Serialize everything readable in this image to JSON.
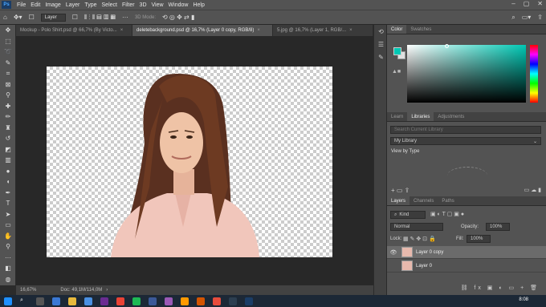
{
  "menubar": {
    "logo": "Ps",
    "items": [
      "File",
      "Edit",
      "Image",
      "Layer",
      "Type",
      "Select",
      "Filter",
      "3D",
      "View",
      "Window",
      "Help"
    ]
  },
  "options": {
    "auto_select": "Layer",
    "mode3d": "3D Mode:"
  },
  "tabs": [
    {
      "label": "Mockup - Polo Shirt.psd @ 66,7% (By Victo...",
      "active": false
    },
    {
      "label": "deletebackground.psd @ 16,7% (Layer 0 copy, RGB/8)",
      "active": true
    },
    {
      "label": "5.jpg @ 16,7% (Layer 1, RGB/...",
      "active": false
    }
  ],
  "status": {
    "zoom": "16,67%",
    "doc": "Doc: 49,1M/114,0M"
  },
  "color_panel": {
    "tabs": [
      "Color",
      "Swatches"
    ],
    "foreground": "#00c8b4",
    "background": "#e0e0e0"
  },
  "libraries": {
    "tabs": [
      "Learn",
      "Libraries",
      "Adjustments"
    ],
    "search_placeholder": "Search Current Library",
    "library": "My Library",
    "view": "View by Type"
  },
  "layers": {
    "tabs": [
      "Layers",
      "Channels",
      "Paths"
    ],
    "filter_kind": "Kind",
    "blend_mode": "Normal",
    "opacity_label": "Opacity:",
    "opacity": "100%",
    "lock_label": "Lock:",
    "fill_label": "Fill:",
    "fill": "100%",
    "items": [
      {
        "name": "Layer 0 copy",
        "visible": true,
        "selected": true
      },
      {
        "name": "Layer 0",
        "visible": false,
        "selected": false
      }
    ]
  },
  "taskbar": {
    "time": "8:08"
  }
}
